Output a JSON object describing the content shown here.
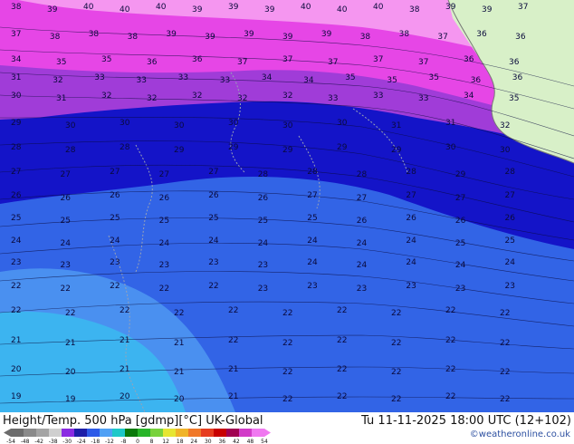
{
  "header": {
    "title_left": "Height/Temp. 500 hPa [gdmp][°C] UK-Global",
    "title_right": "Tu 11-11-2025 18:00 UTC (12+102)",
    "credit": "©weatheronline.co.uk"
  },
  "colorbar": {
    "ticks": [
      "-54",
      "-48",
      "-42",
      "-38",
      "-30",
      "-24",
      "-18",
      "-12",
      "-8",
      "0",
      "8",
      "12",
      "18",
      "24",
      "30",
      "36",
      "42",
      "48",
      "54"
    ],
    "colors": [
      "#6c6c6c",
      "#8a8a8a",
      "#a4a4a4",
      "#cfcfcf",
      "#8a2be2",
      "#1e1ea8",
      "#2d5ae8",
      "#4fa0f5",
      "#1ec8c8",
      "#0a7a0a",
      "#28b428",
      "#78d23c",
      "#e6e632",
      "#f0b428",
      "#f07828",
      "#e63c1e",
      "#c80000",
      "#a00050",
      "#d23cc8",
      "#f078f0"
    ]
  },
  "map": {
    "colors": {
      "deep_blue": "#1414c8",
      "royal_blue": "#3264e6",
      "light_blue": "#4a90f0",
      "cyan_blue": "#3cb4f0",
      "magenta": "#e646e6",
      "pink": "#f596f0",
      "land_green": "#d8f0c8",
      "contour_label": "#0a0a3c"
    },
    "labels": {
      "r1": [
        "38",
        "39",
        "40",
        "40",
        "40",
        "39",
        "39",
        "39",
        "40",
        "40",
        "40",
        "38",
        "39",
        "39",
        "37"
      ],
      "r2": [
        "37",
        "38",
        "38",
        "38",
        "39",
        "39",
        "39",
        "39",
        "39",
        "38",
        "38",
        "37",
        "36",
        "36"
      ],
      "r3": [
        "34",
        "35",
        "35",
        "36",
        "36",
        "37",
        "37",
        "37",
        "37",
        "37",
        "36",
        "36"
      ],
      "r4": [
        "31",
        "32",
        "33",
        "33",
        "33",
        "33",
        "34",
        "34",
        "35",
        "35",
        "35",
        "36",
        "36"
      ],
      "r5": [
        "30",
        "31",
        "32",
        "32",
        "32",
        "32",
        "32",
        "33",
        "33",
        "33",
        "34",
        "35"
      ],
      "r6": [
        "29",
        "30",
        "30",
        "30",
        "30",
        "30",
        "30",
        "31",
        "31",
        "32"
      ],
      "r7": [
        "28",
        "28",
        "28",
        "29",
        "29",
        "29",
        "29",
        "29",
        "30",
        "30"
      ],
      "r8": [
        "27",
        "27",
        "27",
        "27",
        "27",
        "28",
        "28",
        "28",
        "28",
        "29",
        "28"
      ],
      "r9": [
        "26",
        "26",
        "26",
        "26",
        "26",
        "26",
        "27",
        "27",
        "27",
        "27",
        "27"
      ],
      "r10": [
        "25",
        "25",
        "25",
        "25",
        "25",
        "25",
        "25",
        "26",
        "26",
        "26",
        "26"
      ],
      "r11": [
        "24",
        "24",
        "24",
        "24",
        "24",
        "24",
        "24",
        "24",
        "24",
        "25",
        "25"
      ],
      "r12": [
        "23",
        "23",
        "23",
        "23",
        "23",
        "23",
        "24",
        "24",
        "24",
        "24",
        "24"
      ],
      "r13": [
        "22",
        "22",
        "22",
        "22",
        "22",
        "23",
        "23",
        "23",
        "23",
        "23",
        "23"
      ],
      "r14": [
        "22",
        "22",
        "22",
        "22",
        "22",
        "22",
        "22",
        "22",
        "22",
        "22"
      ],
      "r15": [
        "21",
        "21",
        "21",
        "21",
        "22",
        "22",
        "22",
        "22",
        "22",
        "22"
      ],
      "r16": [
        "20",
        "20",
        "21",
        "21",
        "21",
        "22",
        "22",
        "22",
        "22",
        "22"
      ],
      "r17": [
        "19",
        "19",
        "20",
        "20",
        "21",
        "22",
        "22",
        "22",
        "22",
        "22"
      ]
    }
  }
}
